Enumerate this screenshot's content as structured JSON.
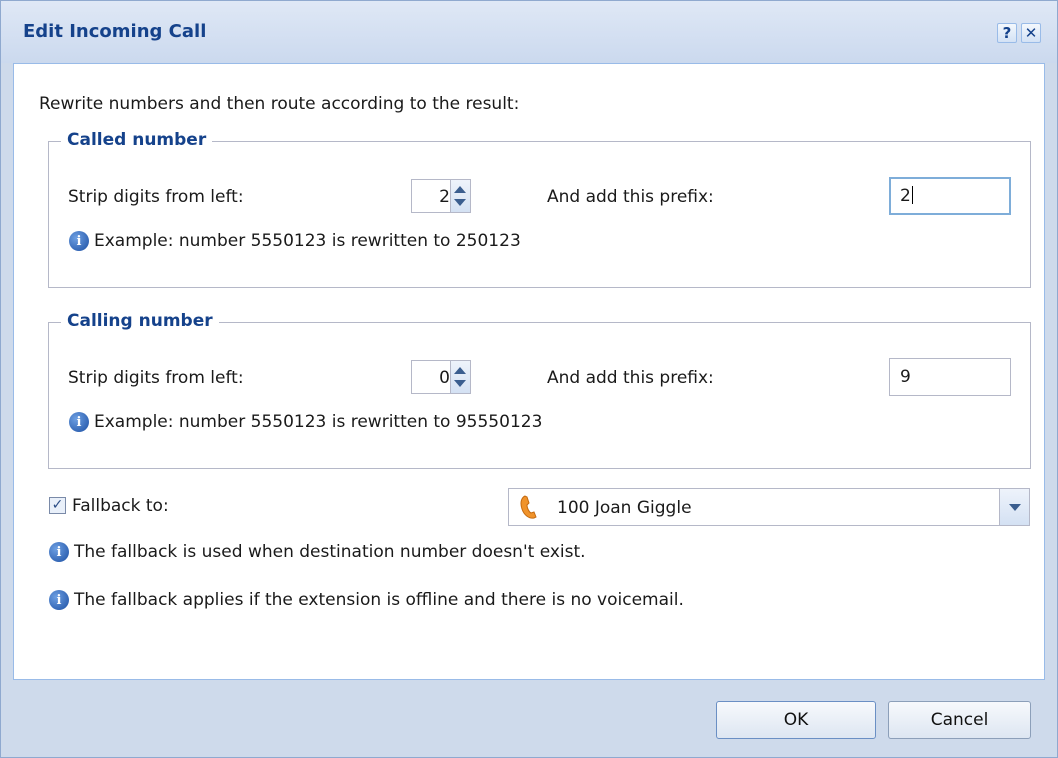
{
  "dialog": {
    "title": "Edit Incoming Call",
    "help_glyph": "?",
    "close_glyph": "✕"
  },
  "intro_text": "Rewrite numbers and then route according to the result:",
  "called": {
    "legend": "Called number",
    "strip_label": "Strip digits from left:",
    "strip_value": "2",
    "prefix_label": "And add this prefix:",
    "prefix_value": "2",
    "example": "Example: number 5550123 is rewritten to 250123"
  },
  "calling": {
    "legend": "Calling number",
    "strip_label": "Strip digits from left:",
    "strip_value": "0",
    "prefix_label": "And add this prefix:",
    "prefix_value": "9",
    "example": "Example: number 5550123 is rewritten to 95550123"
  },
  "fallback": {
    "checked": true,
    "check_glyph": "✓",
    "label": "Fallback to:",
    "selected": "100 Joan Giggle",
    "note1": "The fallback is used when destination number doesn't exist.",
    "note2": "The fallback applies if the extension is offline and there is no voicemail."
  },
  "buttons": {
    "ok": "OK",
    "cancel": "Cancel"
  },
  "icons": {
    "info_glyph": "i",
    "info": "info-icon",
    "phone": "phone-icon",
    "help": "help-icon",
    "close": "close-icon"
  }
}
